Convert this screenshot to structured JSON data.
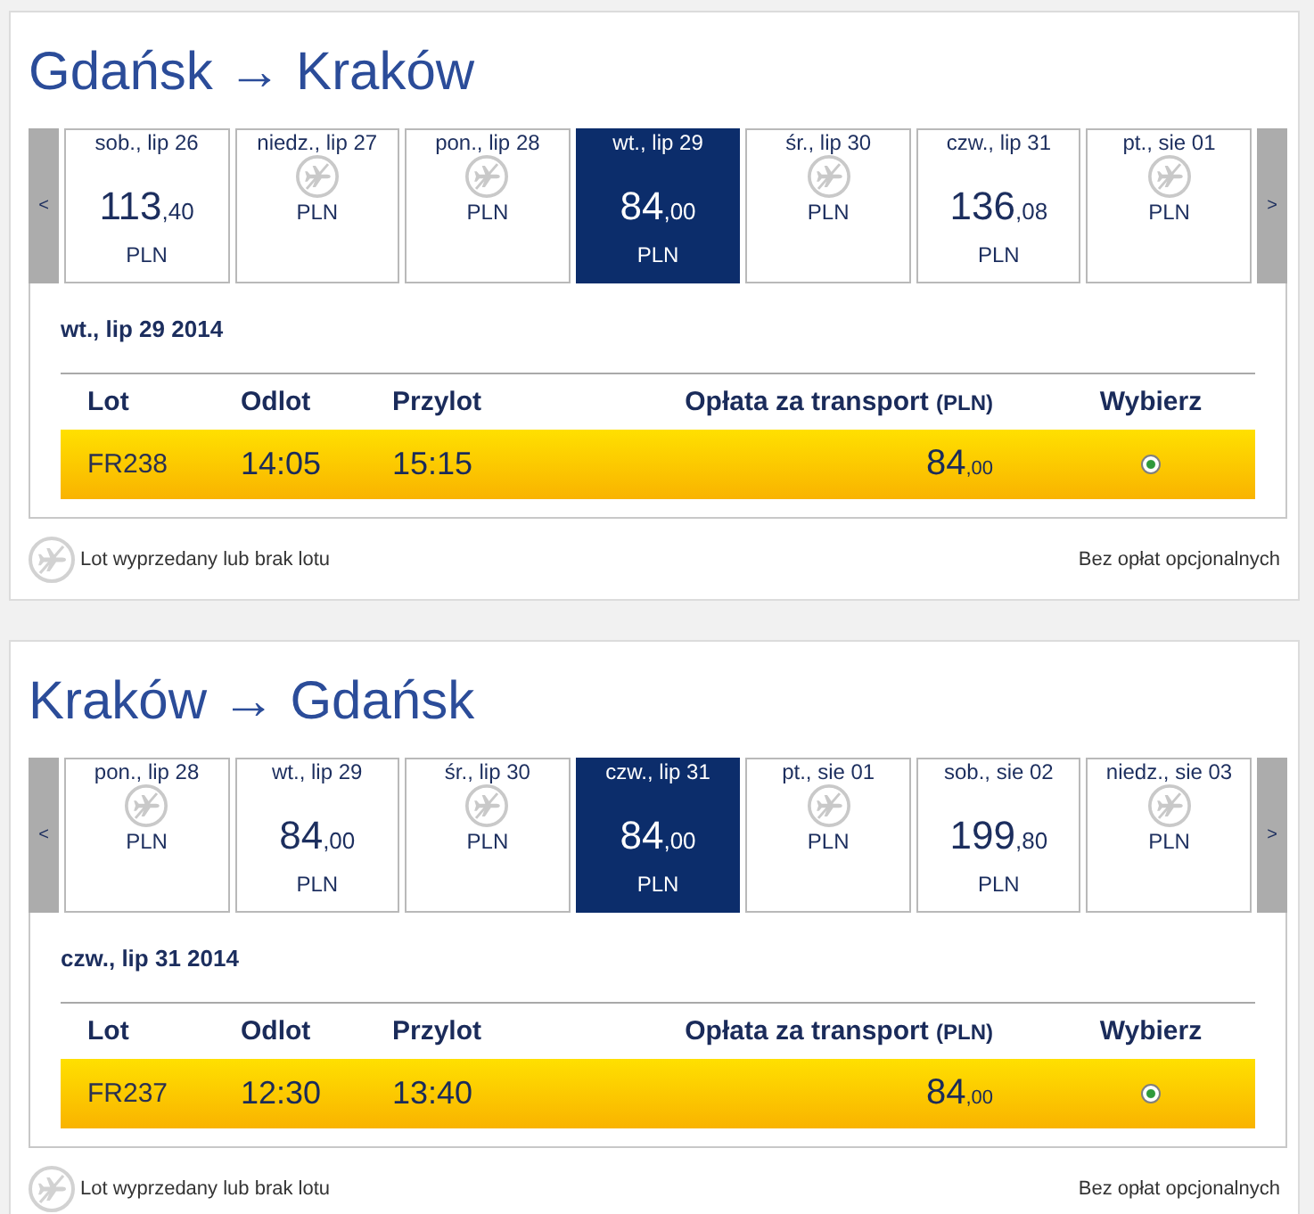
{
  "journeys": [
    {
      "title": "Gdańsk → Kraków",
      "prev_label": "<",
      "next_label": ">",
      "days": [
        {
          "kind": "fare",
          "date": "sob., lip 26",
          "price": "113",
          "price_decimals": ",40",
          "currency": "PLN",
          "selected": false
        },
        {
          "kind": "no_flight",
          "date": "niedz., lip 27",
          "currency": "PLN",
          "selected": false
        },
        {
          "kind": "no_flight",
          "date": "pon., lip 28",
          "currency": "PLN",
          "selected": false
        },
        {
          "kind": "fare",
          "date": "wt., lip 29",
          "price": "84",
          "price_decimals": ",00",
          "currency": "PLN",
          "selected": true
        },
        {
          "kind": "no_flight",
          "date": "śr., lip 30",
          "currency": "PLN",
          "selected": false
        },
        {
          "kind": "fare",
          "date": "czw., lip 31",
          "price": "136",
          "price_decimals": ",08",
          "currency": "PLN",
          "selected": false
        },
        {
          "kind": "no_flight",
          "date": "pt., sie 01",
          "currency": "PLN",
          "selected": false
        }
      ],
      "selected_date": "wt., lip 29 2014",
      "table": {
        "columns": [
          {
            "label": "Lot"
          },
          {
            "label": "Odlot"
          },
          {
            "label": "Przylot"
          },
          {
            "label": "Opłata za transport",
            "unit": "(PLN)"
          },
          {
            "label": "Wybierz"
          }
        ],
        "rows": [
          {
            "flight": "FR238",
            "departure": "14:05",
            "arrival": "15:15",
            "fare": "84",
            "fare_decimals": ",00",
            "selected": true
          }
        ]
      },
      "legend": "Lot wyprzedany lub brak lotu",
      "fees_note": "Bez opłat opcjonalnych"
    },
    {
      "title": "Kraków → Gdańsk",
      "prev_label": "<",
      "next_label": ">",
      "days": [
        {
          "kind": "no_flight",
          "date": "pon., lip 28",
          "currency": "PLN",
          "selected": false
        },
        {
          "kind": "fare",
          "date": "wt., lip 29",
          "price": "84",
          "price_decimals": ",00",
          "currency": "PLN",
          "selected": false
        },
        {
          "kind": "no_flight",
          "date": "śr., lip 30",
          "currency": "PLN",
          "selected": false
        },
        {
          "kind": "fare",
          "date": "czw., lip 31",
          "price": "84",
          "price_decimals": ",00",
          "currency": "PLN",
          "selected": true
        },
        {
          "kind": "no_flight",
          "date": "pt., sie 01",
          "currency": "PLN",
          "selected": false
        },
        {
          "kind": "fare",
          "date": "sob., sie 02",
          "price": "199",
          "price_decimals": ",80",
          "currency": "PLN",
          "selected": false
        },
        {
          "kind": "no_flight",
          "date": "niedz., sie 03",
          "currency": "PLN",
          "selected": false
        }
      ],
      "selected_date": "czw., lip 31 2014",
      "table": {
        "columns": [
          {
            "label": "Lot"
          },
          {
            "label": "Odlot"
          },
          {
            "label": "Przylot"
          },
          {
            "label": "Opłata za transport",
            "unit": "(PLN)"
          },
          {
            "label": "Wybierz"
          }
        ],
        "rows": [
          {
            "flight": "FR237",
            "departure": "12:30",
            "arrival": "13:40",
            "fare": "84",
            "fare_decimals": ",00",
            "selected": true
          }
        ]
      },
      "legend": "Lot wyprzedany lub brak lotu",
      "fees_note": "Bez opłat opcjonalnych"
    }
  ]
}
